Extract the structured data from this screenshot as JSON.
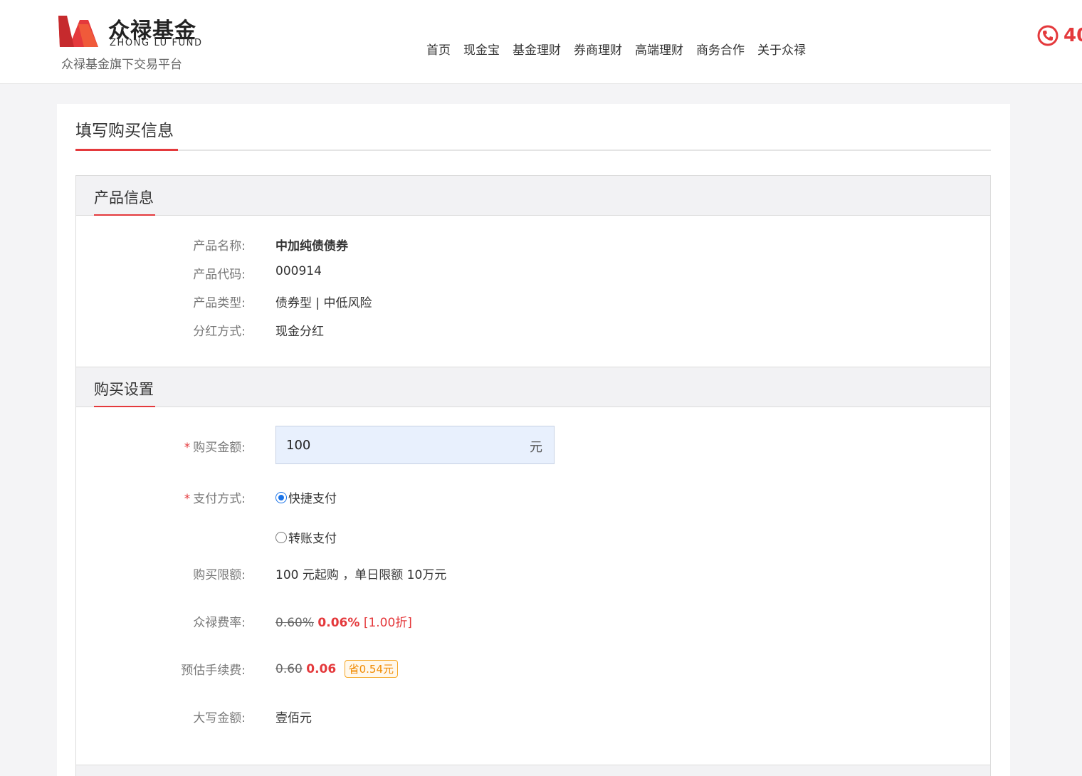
{
  "header": {
    "logo_cn": "众禄基金",
    "logo_en": "ZHONG LU FUND",
    "logo_sub": "众禄基金旗下交易平台",
    "nav": [
      "首页",
      "现金宝",
      "基金理财",
      "券商理财",
      "高端理财",
      "商务合作",
      "关于众禄"
    ],
    "phone_partial": "40"
  },
  "page": {
    "title": "填写购买信息"
  },
  "product_info": {
    "heading": "产品信息",
    "rows": [
      {
        "label": "产品名称:",
        "value": "中加纯债债券"
      },
      {
        "label": "产品代码:",
        "value": "000914"
      },
      {
        "label": "产品类型:",
        "value": "债券型 | 中低风险"
      },
      {
        "label": "分红方式:",
        "value": "现金分红"
      }
    ]
  },
  "purchase": {
    "heading": "购买设置",
    "amount_label": "购买金额:",
    "amount_value": "100",
    "amount_unit": "元",
    "pay_label": "支付方式:",
    "pay_options": [
      "快捷支付",
      "转账支付"
    ],
    "selected_pay": "快捷支付",
    "limit_label": "购买限额:",
    "limit_value": "100 元起购 ，单日限额 10万元",
    "fee_rate_label": "众禄费率:",
    "fee_rate_old": "0.60%",
    "fee_rate_new": "0.06%",
    "fee_rate_discount": "[1.00折]",
    "fee_label": "预估手续费:",
    "fee_old": "0.60",
    "fee_new": "0.06",
    "fee_saving": "省0.54元",
    "upper_label": "大写金额:",
    "upper_value": "壹佰元"
  },
  "colors": {
    "accent": "#e4393c",
    "input_bg": "#e8f0fd",
    "badge": "#f5a623"
  }
}
